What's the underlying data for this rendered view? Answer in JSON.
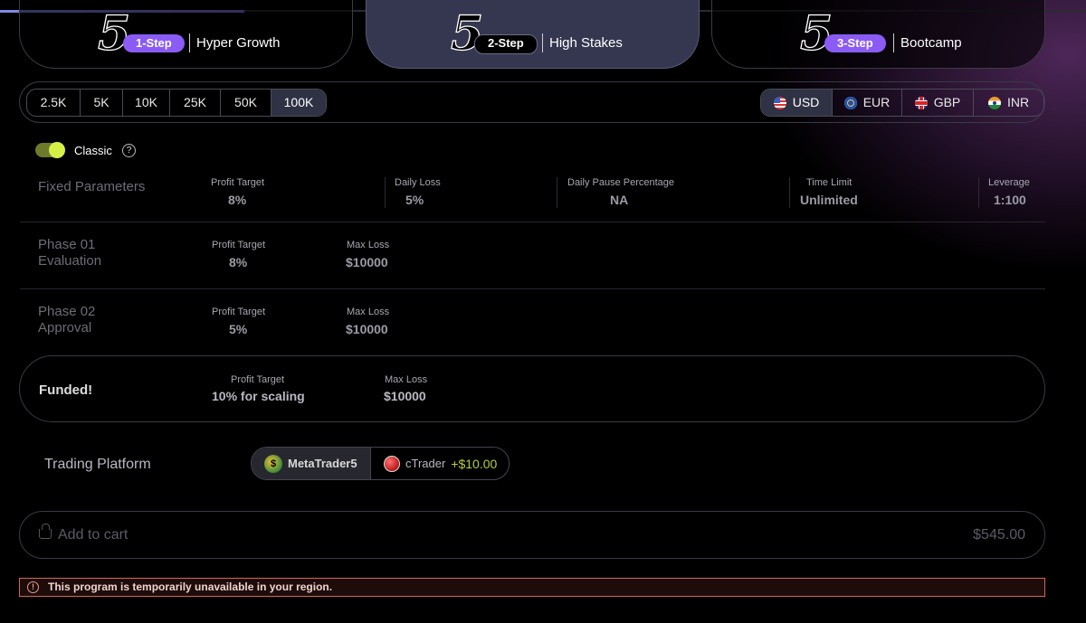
{
  "programs": [
    {
      "number": "5",
      "step": "1-Step",
      "name": "Hyper Growth"
    },
    {
      "number": "5",
      "step": "2-Step",
      "name": "High Stakes"
    },
    {
      "number": "5",
      "step": "3-Step",
      "name": "Bootcamp"
    }
  ],
  "sizes": [
    "2.5K",
    "5K",
    "10K",
    "25K",
    "50K",
    "100K"
  ],
  "selected_size": "100K",
  "currencies": [
    {
      "code": "USD",
      "icon": "us-flag-icon"
    },
    {
      "code": "EUR",
      "icon": "eu-flag-icon"
    },
    {
      "code": "GBP",
      "icon": "uk-flag-icon"
    },
    {
      "code": "INR",
      "icon": "india-flag-icon"
    }
  ],
  "selected_currency": "USD",
  "mode": {
    "label": "Classic",
    "enabled": true,
    "help": "?"
  },
  "fixed": {
    "title": "Fixed Parameters",
    "profit_target": {
      "label": "Profit Target",
      "value": "8%"
    },
    "daily_loss": {
      "label": "Daily Loss",
      "value": "5%"
    },
    "daily_pause": {
      "label": "Daily Pause Percentage",
      "value": "NA"
    },
    "time_limit": {
      "label": "Time Limit",
      "value": "Unlimited"
    },
    "leverage": {
      "label": "Leverage",
      "value": "1:100"
    }
  },
  "phase1": {
    "title1": "Phase 01",
    "title2": "Evaluation",
    "profit_target": {
      "label": "Profit Target",
      "value": "8%"
    },
    "max_loss": {
      "label": "Max Loss",
      "value": "$10000"
    }
  },
  "phase2": {
    "title1": "Phase 02",
    "title2": "Approval",
    "profit_target": {
      "label": "Profit Target",
      "value": "5%"
    },
    "max_loss": {
      "label": "Max Loss",
      "value": "$10000"
    }
  },
  "funded": {
    "title": "Funded!",
    "profit_target": {
      "label": "Profit Target",
      "value": "10% for scaling"
    },
    "max_loss": {
      "label": "Max Loss",
      "value": "$10000"
    }
  },
  "platform": {
    "label": "Trading Platform",
    "options": [
      {
        "name": "MetaTrader5",
        "addon": ""
      },
      {
        "name": "cTrader",
        "addon": "+$10.00"
      }
    ],
    "selected": "MetaTrader5"
  },
  "cart": {
    "label": "Add to cart",
    "price": "$545.00"
  },
  "alert": {
    "text": "This program is temporarily unavailable in your region.",
    "icon": "!"
  },
  "colors": {
    "accent": "#8a5cf5",
    "toggle": "#d6f04a",
    "addon": "#b3cf3a",
    "alert_border": "#d2655b"
  }
}
